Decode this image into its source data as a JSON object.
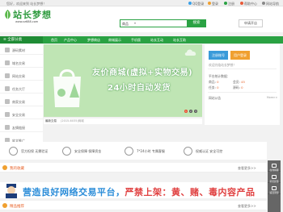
{
  "topbar": {
    "welcome": "您好，欢迎来到 站长梦想！",
    "qq_login": "QQ登录",
    "login": "登录",
    "register": "注册",
    "service_center": "帮助中心",
    "help": "网站导航"
  },
  "header": {
    "logo_text": "站长梦想",
    "logo_url": "www.zz688.com",
    "search_category": "商品",
    "search_placeholder": "",
    "search_button": "搜索",
    "apply_button": "申请开店"
  },
  "nav": {
    "all_categories": "全部分类",
    "items": [
      "首页",
      "产品中心",
      "梦想商店",
      "商城展示",
      "手机版",
      "站长互动",
      "站长互助"
    ]
  },
  "sidebar": {
    "items": [
      {
        "label": "源码素材",
        "icon": "code-icon"
      },
      {
        "label": "域名交易",
        "icon": "globe-icon"
      },
      {
        "label": "网站交易",
        "icon": "website-icon"
      },
      {
        "label": "任务大厅",
        "icon": "task-icon"
      },
      {
        "label": "商家交易",
        "icon": "shop-icon"
      },
      {
        "label": "安全交易",
        "icon": "lock-icon"
      },
      {
        "label": "友情链接",
        "icon": "link-icon"
      },
      {
        "label": "软文推广",
        "icon": "article-icon"
      }
    ]
  },
  "banner": {
    "line1": "友价商城(虚拟+实物交易)",
    "line2": "24小时自动发货",
    "pages": [
      "1",
      "2",
      "3"
    ],
    "active_page": "1"
  },
  "news": {
    "label": "最新交易",
    "text": "(2015-6035)商城"
  },
  "right_panel": {
    "register_button": "注册账号",
    "login_button": "用户登录",
    "announcement": "欢迎光临站长梦想！",
    "stats_label": "平台统计数据：",
    "stats": [
      {
        "label": "商品",
        "value": "0"
      },
      {
        "label": "会员",
        "value": "45"
      },
      {
        "label": "任务",
        "value": "0"
      },
      {
        "label": "源码",
        "value": "0"
      }
    ],
    "site_notice": "网站公告",
    "more": "More>>"
  },
  "colors": {
    "primary_green": "#2aa243",
    "nav_dark_green": "#1f8c35",
    "login_orange": "#f0a030",
    "register_blue": "#3a9ad9",
    "section_orange": "#e8632a"
  },
  "features": [
    {
      "label": "官方担保",
      "icon": "handshake-icon"
    },
    {
      "label": "无需验证",
      "icon": "check-shield-icon"
    },
    {
      "label": "安全保障",
      "icon": "safe-icon"
    },
    {
      "label": "7*24小时",
      "icon": "clock-icon"
    },
    {
      "label": "权威认证",
      "icon": "certificate-icon"
    }
  ],
  "feature_texts": [
    "官方担保 无需验证",
    "安全保障 保障资金",
    "7*24小时 专属客服",
    "权威认证 安全可控"
  ],
  "sections": {
    "recommend": {
      "title": "我的收藏",
      "more": "查看更多>>"
    },
    "hot": {
      "title": "精品推荐",
      "more": "查看更多>>"
    }
  },
  "ad": {
    "part1": "营造良好网络交易平台，",
    "part2": "严禁上架：黄、赌、毒内容产品"
  },
  "floatbar": {
    "items": [
      "在线客服",
      "意见反馈",
      "返回顶部"
    ]
  }
}
